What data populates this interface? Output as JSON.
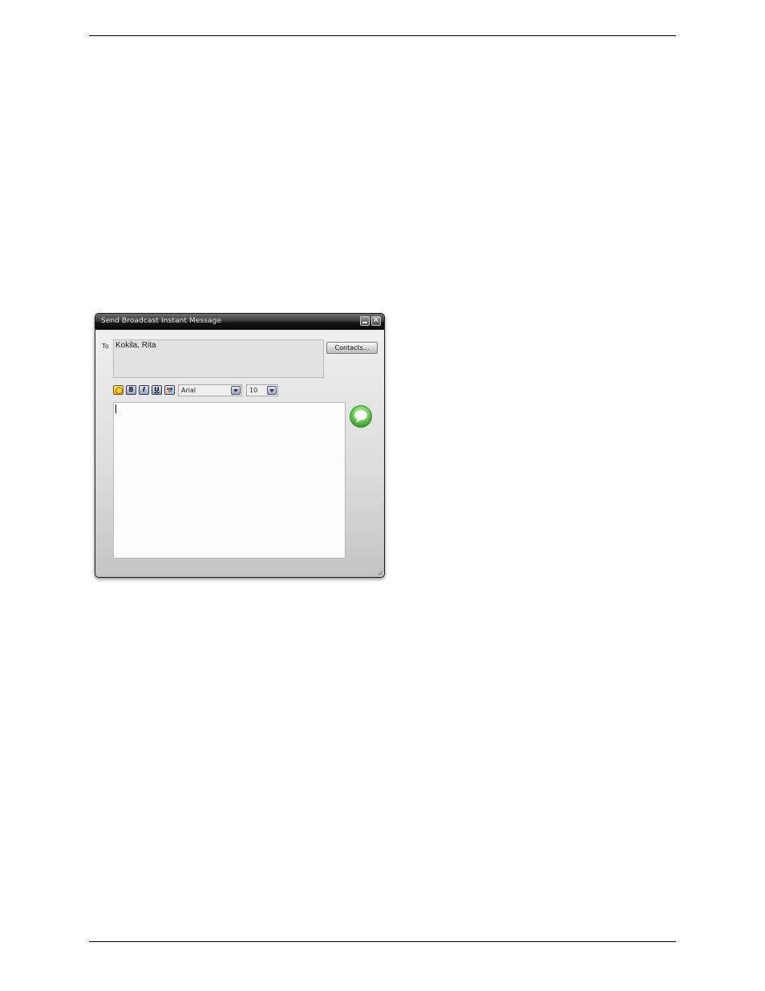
{
  "window": {
    "title": "Send Broadcast Instant Message",
    "close_glyph": "✕"
  },
  "recipients": {
    "label": "To",
    "value": "Kokila, Rita"
  },
  "contacts_button": "Contacts...",
  "format_toolbar": {
    "bold": "B",
    "italic": "I",
    "underline": "U",
    "font": "Arial",
    "size": "10"
  },
  "icons": {
    "emoticon": "emoticon-icon",
    "color": "text-color-icon",
    "send": "send-speech-bubble-icon",
    "minimize": "minimize-icon",
    "close": "close-icon",
    "dropdown": "chevron-down-icon",
    "resize": "resize-grip-icon"
  },
  "colors": {
    "titlebar": "#151515",
    "send_accent": "#5cbf4a",
    "message_bg": "#fdfdfd"
  }
}
